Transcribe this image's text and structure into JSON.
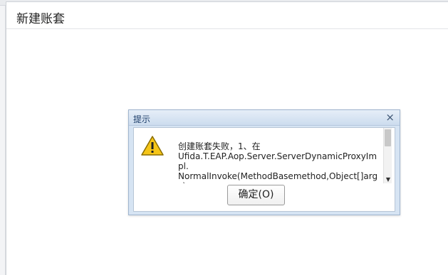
{
  "window": {
    "title": "新建账套"
  },
  "dialog": {
    "title": "提示",
    "close_glyph": "×",
    "message": "创建账套失败，1、在\nUfida.T.EAP.Aop.Server.ServerDynamicProxyImpl.\nNormalInvoke(MethodBasemethod,Object[]args)\n在\nUfida.T.EAP.Aop.Server.ServerDynamicProxyImpl.",
    "ok_label": "确定(O)",
    "scroll_down_glyph": "▼"
  },
  "icons": {
    "warning": "warning-icon",
    "close": "close-icon"
  },
  "colors": {
    "title_bar": "#d6e4f3",
    "warning": "#f5c518"
  }
}
